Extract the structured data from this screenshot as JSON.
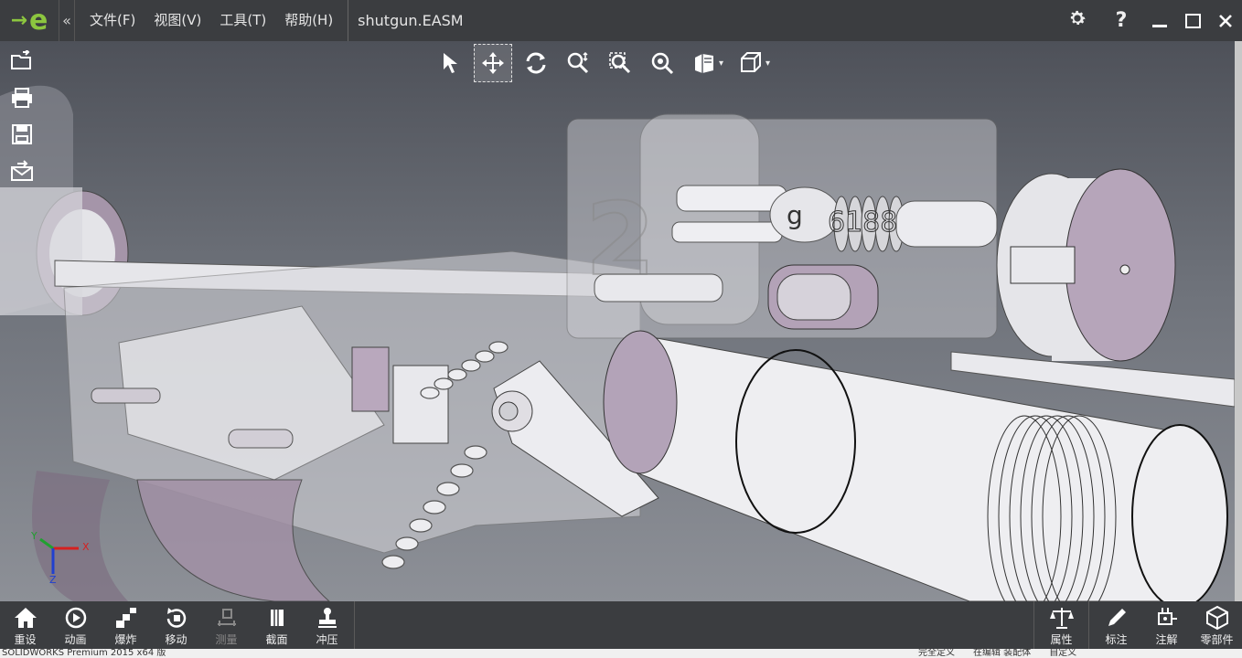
{
  "app": {
    "logo_text": "e",
    "collapse_glyph": "«"
  },
  "menu": [
    {
      "label": "文件(F)"
    },
    {
      "label": "视图(V)"
    },
    {
      "label": "工具(T)"
    },
    {
      "label": "帮助(H)"
    }
  ],
  "document": {
    "filename": "shutgun.EASM"
  },
  "window_controls": {
    "settings_icon": "gear-icon",
    "help_label": "?"
  },
  "side_tools": [
    "open-file-icon",
    "print-icon",
    "save-icon",
    "email-icon"
  ],
  "view_toolbar": [
    {
      "icon": "select-arrow-icon",
      "active": false
    },
    {
      "icon": "pan-icon",
      "active": true
    },
    {
      "icon": "rotate-icon",
      "active": false
    },
    {
      "icon": "zoom-icon",
      "active": false
    },
    {
      "icon": "zoom-area-icon",
      "active": false
    },
    {
      "icon": "zoom-fit-icon",
      "active": false
    },
    {
      "icon": "view-state-icon",
      "active": false,
      "dropdown": true
    },
    {
      "icon": "standard-view-icon",
      "active": false,
      "dropdown": true
    }
  ],
  "viewport": {
    "model_text": "6188",
    "model_text_prefix": "g",
    "triad": {
      "x_label": "X",
      "y_label": "Y",
      "z_label": "Z"
    }
  },
  "bottom_tools_left": [
    {
      "label": "重设",
      "icon": "home-icon",
      "enabled": true
    },
    {
      "label": "动画",
      "icon": "animation-icon",
      "enabled": true
    },
    {
      "label": "爆炸",
      "icon": "explode-icon",
      "enabled": true
    },
    {
      "label": "移动",
      "icon": "move-icon",
      "enabled": true
    },
    {
      "label": "测量",
      "icon": "measure-icon",
      "enabled": false
    },
    {
      "label": "截面",
      "icon": "section-icon",
      "enabled": true
    },
    {
      "label": "冲压",
      "icon": "stamp-icon",
      "enabled": true
    }
  ],
  "bottom_tools_right": [
    {
      "label": "属性",
      "icon": "scale-icon"
    },
    {
      "label": "标注",
      "icon": "pencil-icon"
    },
    {
      "label": "注解",
      "icon": "annotation-icon"
    },
    {
      "label": "零部件",
      "icon": "components-icon"
    }
  ],
  "status": {
    "left": "SOLIDWORKS Premium 2015 x64 版",
    "right": [
      "完全定义",
      "在编辑 装配体",
      "自定义"
    ]
  },
  "colors": {
    "accent": "#8cc63f",
    "titlebar": "#3b3d40",
    "part_purple": "#9b8aa0",
    "part_white": "#e8e8ec"
  }
}
